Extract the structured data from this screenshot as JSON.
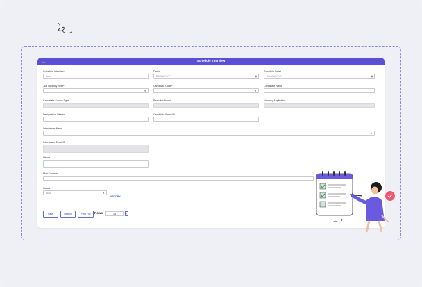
{
  "window": {
    "title": "Schedule Interview",
    "accent": "#5b4fd6",
    "back_icon": "arrow-left-icon"
  },
  "form": {
    "schedule_interview": {
      "label": "Schedule Interview",
      "value": "Auto"
    },
    "date": {
      "label": "Date*",
      "placeholder": "DD/MM/YYYY"
    },
    "schedule_date": {
      "label": "Schedule Date*",
      "placeholder": "DD/MM/YYYY"
    },
    "job_vacancy_code": {
      "label": "Job Vacancy code*",
      "value": ""
    },
    "candidate_code": {
      "label": "Candidate Code*",
      "value": ""
    },
    "candidate_name": {
      "label": "Candidate Name",
      "value": ""
    },
    "candidate_source_type": {
      "label": "Candidate Source Type",
      "value": ""
    },
    "recruiter_name": {
      "label": "Recruiter Name",
      "value": ""
    },
    "vacancy_applied_for": {
      "label": "Vacancy Applied for",
      "value": ""
    },
    "designation_offered": {
      "label": "Designation Offered",
      "value": ""
    },
    "candidate_email": {
      "label": "Candidate Email ID",
      "value": ""
    },
    "interviewer_name": {
      "label": "Interviewer Name",
      "value": ""
    },
    "interviewer_email": {
      "label": "Interviewer Email ID",
      "value": ""
    },
    "venue": {
      "label": "Venue",
      "value": ""
    },
    "mail_contents": {
      "label": "Mail Contents",
      "value": ""
    },
    "status": {
      "label": "Status",
      "value": "Auto"
    },
    "history_link": "HISTORY"
  },
  "toolbar": {
    "save_label": "Save",
    "search_label": "Search",
    "print_label": "Print (S)",
    "rows_label": "Rows:",
    "rows_value": "15"
  }
}
